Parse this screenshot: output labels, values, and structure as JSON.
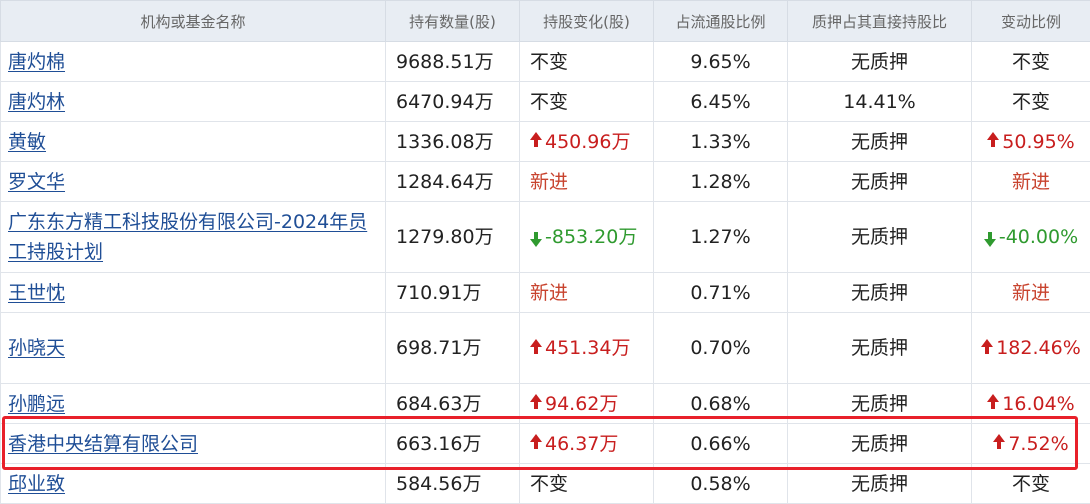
{
  "table": {
    "headers": [
      "机构或基金名称",
      "持有数量(股)",
      "持股变化(股)",
      "占流通股比例",
      "质押占其直接持股比",
      "变动比例"
    ],
    "rows": [
      {
        "name": "唐灼棉",
        "qty": "9688.51万",
        "change": "不变",
        "change_dir": "none",
        "ratio": "9.65%",
        "pledge": "无质押",
        "var": "不变",
        "var_dir": "none"
      },
      {
        "name": "唐灼林",
        "qty": "6470.94万",
        "change": "不变",
        "change_dir": "none",
        "ratio": "6.45%",
        "pledge": "14.41%",
        "var": "不变",
        "var_dir": "none"
      },
      {
        "name": "黄敏",
        "qty": "1336.08万",
        "change": "450.96万",
        "change_dir": "up",
        "ratio": "1.33%",
        "pledge": "无质押",
        "var": "50.95%",
        "var_dir": "up"
      },
      {
        "name": "罗文华",
        "qty": "1284.64万",
        "change": "新进",
        "change_dir": "new",
        "ratio": "1.28%",
        "pledge": "无质押",
        "var": "新进",
        "var_dir": "new"
      },
      {
        "name": "广东东方精工科技股份有限公司-2024年员工持股计划",
        "qty": "1279.80万",
        "change": "-853.20万",
        "change_dir": "down",
        "ratio": "1.27%",
        "pledge": "无质押",
        "var": "-40.00%",
        "var_dir": "down",
        "tall": true
      },
      {
        "name": "王世忱",
        "qty": "710.91万",
        "change": "新进",
        "change_dir": "new",
        "ratio": "0.71%",
        "pledge": "无质押",
        "var": "新进",
        "var_dir": "new"
      },
      {
        "name": "孙晓天",
        "qty": "698.71万",
        "change": "451.34万",
        "change_dir": "up",
        "ratio": "0.70%",
        "pledge": "无质押",
        "var": "182.46%",
        "var_dir": "up",
        "tall": true
      },
      {
        "name": "孙鹏远",
        "qty": "684.63万",
        "change": "94.62万",
        "change_dir": "up",
        "ratio": "0.68%",
        "pledge": "无质押",
        "var": "16.04%",
        "var_dir": "up"
      },
      {
        "name": "香港中央结算有限公司",
        "qty": "663.16万",
        "change": "46.37万",
        "change_dir": "up",
        "ratio": "0.66%",
        "pledge": "无质押",
        "var": "7.52%",
        "var_dir": "up",
        "highlighted": true
      },
      {
        "name": "邱业致",
        "qty": "584.56万",
        "change": "不变",
        "change_dir": "none",
        "ratio": "0.58%",
        "pledge": "无质押",
        "var": "不变",
        "var_dir": "none"
      }
    ]
  },
  "colors": {
    "up": "#c81e1e",
    "down": "#2f9a2f",
    "new": "#c8432e",
    "link": "#1f4e96",
    "highlight_border": "#e8202a",
    "header_bg": "#e8edf3"
  },
  "icons": {
    "up": "arrow-up-icon",
    "down": "arrow-down-icon"
  }
}
